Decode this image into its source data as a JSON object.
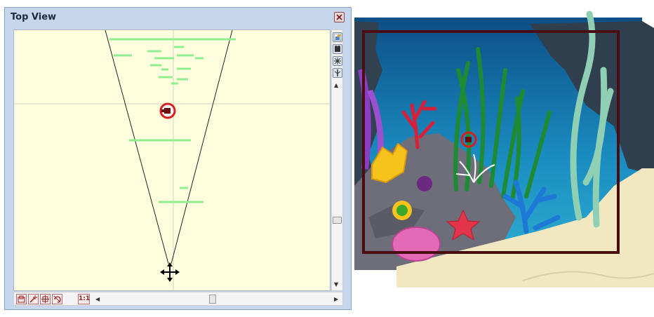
{
  "window": {
    "title": "Top View"
  },
  "toolbar_vertical": {
    "icons": [
      "render-icon",
      "camera-icon",
      "pan-icon",
      "pegbar-icon"
    ]
  },
  "toolbar_bottom": {
    "icons": [
      "fit-icon",
      "magic-wand-icon",
      "pan-view-icon",
      "reset-rotate-icon"
    ],
    "zoom_label": "1:1"
  },
  "scrollbars": {
    "up_arrow": "▲",
    "down_arrow": "▼",
    "left_arrow": "◀",
    "right_arrow": "▶"
  },
  "colors": {
    "panel_bg": "#c6d6ec",
    "viewport_bg": "#fefede",
    "layer_line": "#90ee90",
    "camera_marker": "#d81e1e",
    "frame": "#4a0e12"
  }
}
